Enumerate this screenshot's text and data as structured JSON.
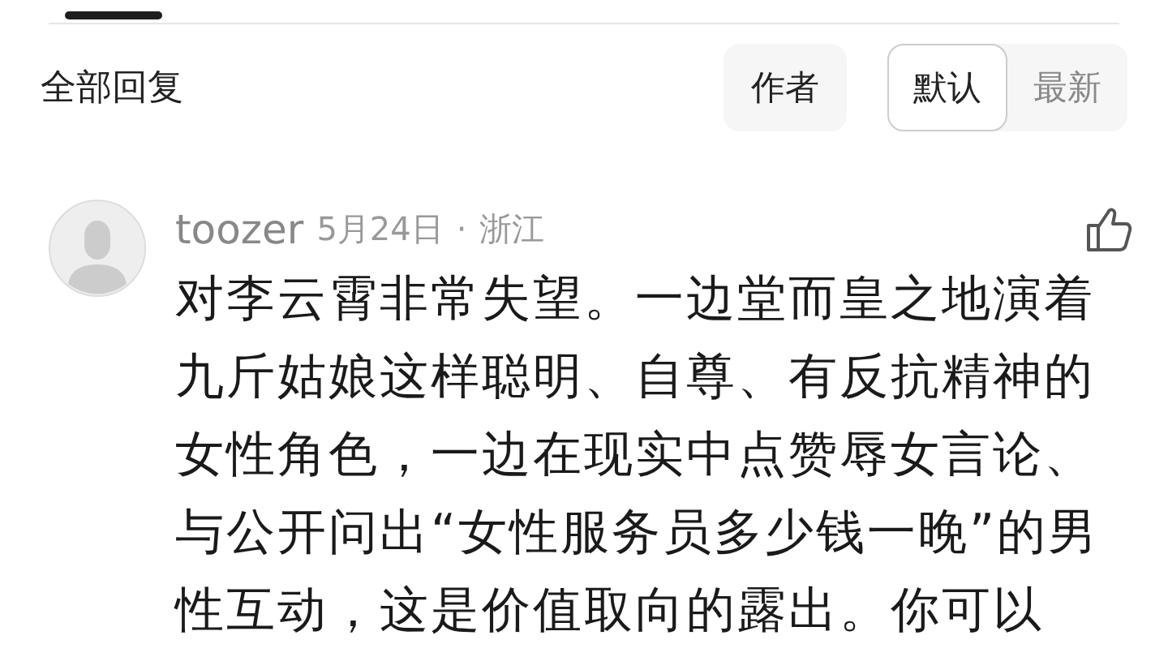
{
  "header": {
    "title": "全部回复",
    "filters": [
      {
        "label": "作者",
        "selected": false
      }
    ],
    "sort": [
      {
        "label": "默认",
        "selected": true
      },
      {
        "label": "最新",
        "selected": false
      }
    ]
  },
  "comments": [
    {
      "user": "toozer",
      "date": "5月24日",
      "separator": "·",
      "location": "浙江",
      "text": "对李云霄非常失望。一边堂而皇之地演着九斤姑娘这样聪明、自尊、有反抗精神的女性角色，一边在现实中点赞辱女言论、与公开问出“女性服务员多少钱一晚”的男性互动，这是价值取向的露出。你可以"
    }
  ]
}
